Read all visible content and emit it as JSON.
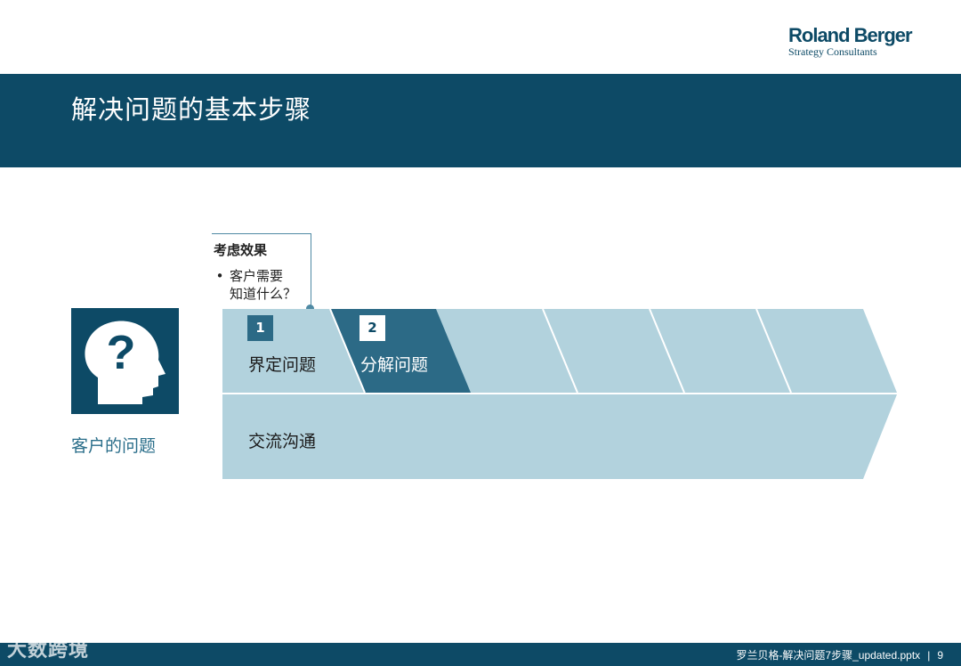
{
  "logo": {
    "main": "Roland Berger",
    "sub": "Strategy Consultants"
  },
  "title": "解决问题的基本步骤",
  "client": {
    "label": "客户的问题",
    "icon": "head-question-icon"
  },
  "callout": {
    "title": "考虑效果",
    "bullet": "•",
    "line1": "客户需要",
    "line2": "知道什么？"
  },
  "steps": [
    {
      "number": "1",
      "label": "界定问题"
    },
    {
      "number": "2",
      "label": "分解问题"
    }
  ],
  "communication": {
    "label": "交流沟通"
  },
  "footer": {
    "file": "罗兰贝格-解决问题7步骤_updated.pptx",
    "separator": "|",
    "page": "9"
  },
  "watermark": "大数跨境",
  "colors": {
    "navy": "#0d4a66",
    "light_band": "#b2d2dd",
    "active_step": "#2c6a86"
  }
}
